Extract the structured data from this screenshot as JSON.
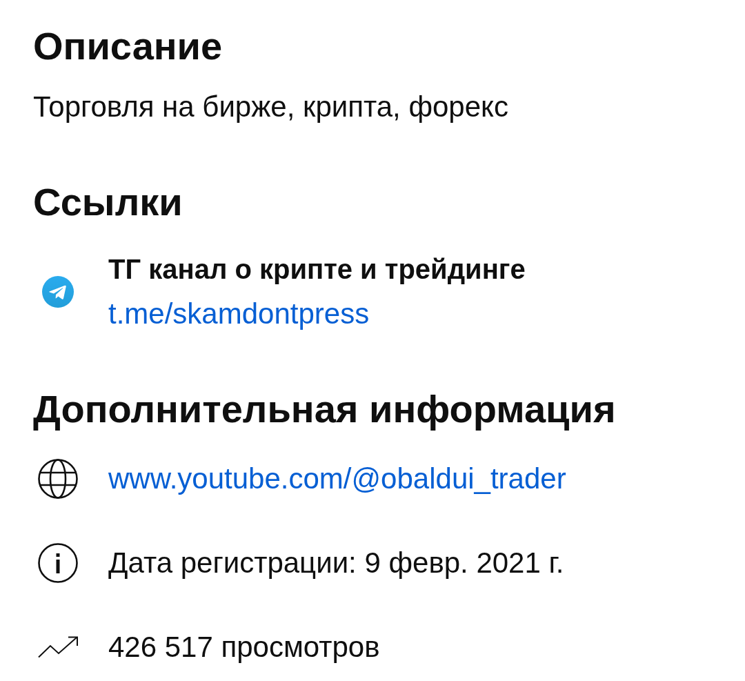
{
  "description": {
    "heading": "Описание",
    "text": "Торговля на бирже, крипта, форекс"
  },
  "links": {
    "heading": "Ссылки",
    "items": [
      {
        "kind": "telegram",
        "title": "ТГ канал о крипте и трейдинге",
        "url": "t.me/skamdontpress"
      }
    ]
  },
  "additional_info": {
    "heading": "Дополнительная информация",
    "items": [
      {
        "kind": "website",
        "text": "www.youtube.com/@obaldui_trader"
      },
      {
        "kind": "joined",
        "text": "Дата регистрации: 9 февр. 2021 г."
      },
      {
        "kind": "views",
        "text": "426 517 просмотров"
      }
    ]
  }
}
